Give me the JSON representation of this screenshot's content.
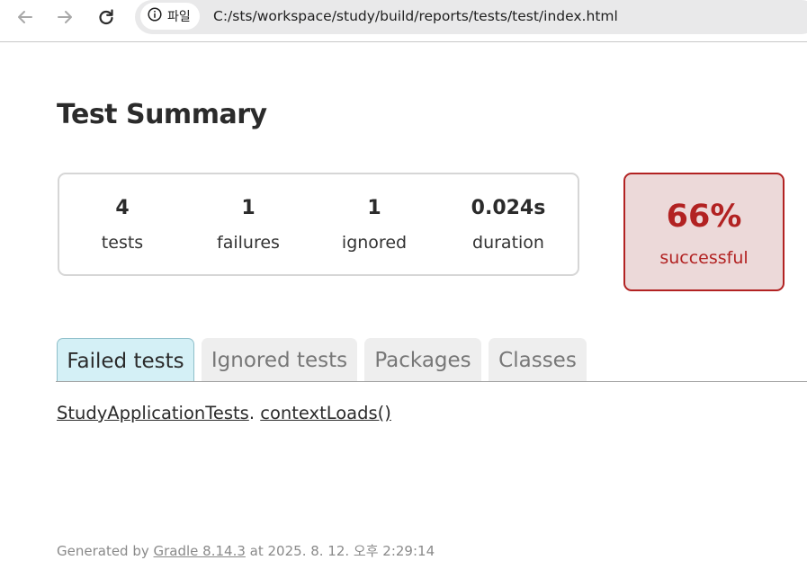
{
  "browser": {
    "back_icon": "arrow-left-icon",
    "forward_icon": "arrow-right-icon",
    "reload_icon": "reload-icon",
    "site_info_icon": "info-circle-icon",
    "site_chip_label": "파일",
    "url": "C:/sts/workspace/study/build/reports/tests/test/index.html"
  },
  "page": {
    "title": "Test Summary"
  },
  "summary": {
    "counters": [
      {
        "value": "4",
        "label": "tests"
      },
      {
        "value": "1",
        "label": "failures"
      },
      {
        "value": "1",
        "label": "ignored"
      },
      {
        "value": "0.024s",
        "label": "duration"
      }
    ],
    "success_rate": "66%",
    "success_label": "successful"
  },
  "tabs": [
    {
      "label": "Failed tests",
      "selected": true
    },
    {
      "label": "Ignored tests",
      "selected": false
    },
    {
      "label": "Packages",
      "selected": false
    },
    {
      "label": "Classes",
      "selected": false
    }
  ],
  "failed_tests": [
    {
      "class_name": "StudyApplicationTests",
      "separator": ".",
      "method": "contextLoads()"
    }
  ],
  "footer": {
    "prefix": "Generated by ",
    "tool_link": "Gradle 8.14.3",
    "suffix": " at 2025. 8. 12. 오후 2:29:14"
  },
  "colors": {
    "failure_accent": "#b22222",
    "failure_bg": "#ecd9d9",
    "selected_tab_bg": "#d4f0f6",
    "tab_bg": "#eeeeee"
  }
}
